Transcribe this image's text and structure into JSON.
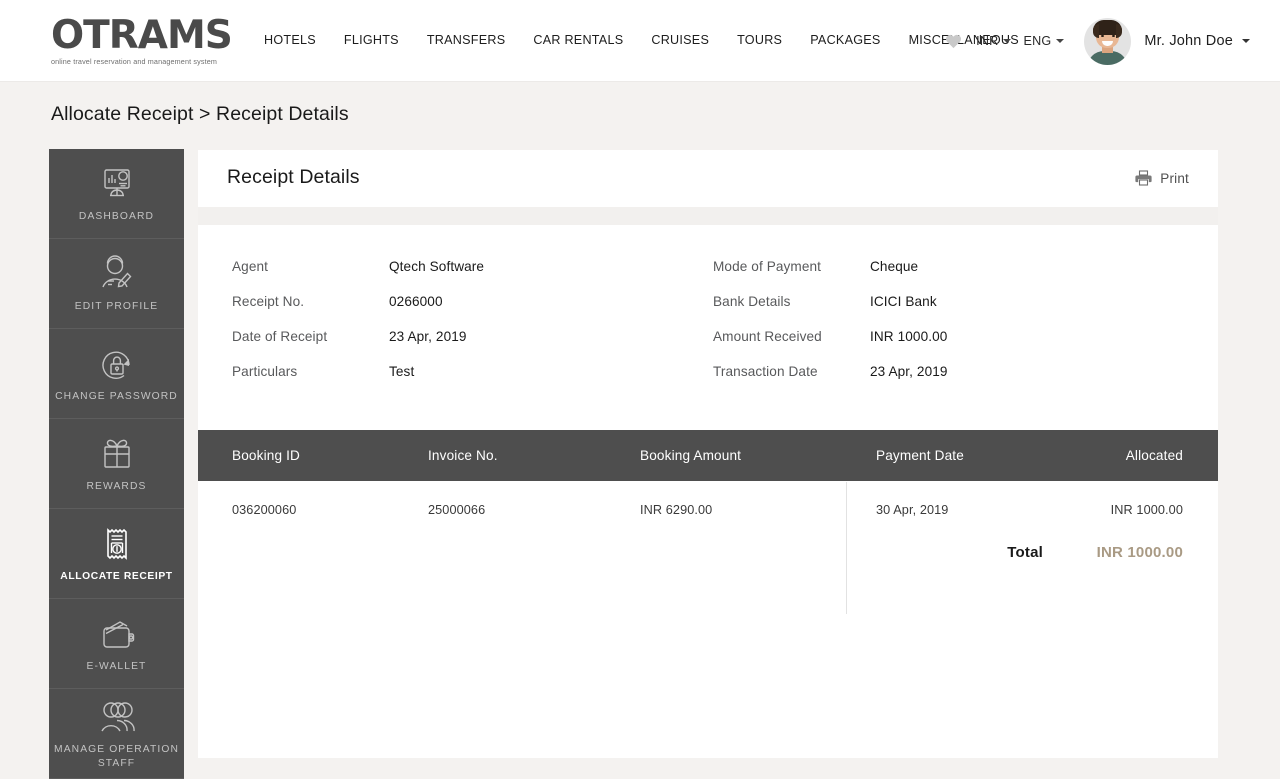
{
  "header": {
    "logo_text": "OTRAMS",
    "logo_tagline": "online travel reservation and management system",
    "nav": [
      {
        "label": "HOTELS"
      },
      {
        "label": "FLIGHTS"
      },
      {
        "label": "TRANSFERS"
      },
      {
        "label": "CAR RENTALS"
      },
      {
        "label": "CRUISES"
      },
      {
        "label": "TOURS"
      },
      {
        "label": "PACKAGES"
      },
      {
        "label": "MISCELLANEOUS"
      }
    ],
    "currency": "INR",
    "language": "ENG",
    "user_name": "Mr. John Doe"
  },
  "breadcrumb": "Allocate Receipt > Receipt  Details",
  "sidebar": {
    "items": [
      {
        "label": "DASHBOARD",
        "icon": "dashboard-icon",
        "active": false
      },
      {
        "label": "EDIT PROFILE",
        "icon": "user-edit-icon",
        "active": false
      },
      {
        "label": "CHANGE PASSWORD",
        "icon": "lock-refresh-icon",
        "active": false
      },
      {
        "label": "REWARDS",
        "icon": "gift-icon",
        "active": false
      },
      {
        "label": "ALLOCATE RECEIPT",
        "icon": "receipt-icon",
        "active": true
      },
      {
        "label": "E-WALLET",
        "icon": "wallet-icon",
        "active": false
      },
      {
        "label": "MANAGE OPERATION STAFF",
        "icon": "users-icon",
        "active": false
      }
    ]
  },
  "main": {
    "title": "Receipt  Details",
    "print_label": "Print",
    "details_left": [
      {
        "label": "Agent",
        "value": "Qtech Software"
      },
      {
        "label": "Receipt No.",
        "value": "0266000"
      },
      {
        "label": "Date of Receipt",
        "value": "23 Apr, 2019"
      },
      {
        "label": "Particulars",
        "value": "Test"
      }
    ],
    "details_right": [
      {
        "label": "Mode of Payment",
        "value": "Cheque"
      },
      {
        "label": "Bank Details",
        "value": "ICICI Bank"
      },
      {
        "label": "Amount Received",
        "value": "INR 1000.00"
      },
      {
        "label": "Transaction Date",
        "value": "23 Apr, 2019"
      }
    ],
    "table": {
      "columns": [
        "Booking ID",
        "Invoice No.",
        "Booking Amount",
        "Payment Date",
        "Allocated"
      ],
      "rows": [
        {
          "booking_id": "036200060",
          "invoice_no": "25000066",
          "booking_amount": "INR 6290.00",
          "payment_date": "30 Apr, 2019",
          "allocated": "INR 1000.00"
        }
      ],
      "total_label": "Total",
      "total_value": "INR 1000.00"
    }
  },
  "colors": {
    "sidebar_bg": "#4e4e4e",
    "table_header_bg": "#4e4e4e",
    "gold_accent": "#a99a84",
    "link_blue": "#4a7ba8",
    "page_bg": "#f4f2f0"
  }
}
